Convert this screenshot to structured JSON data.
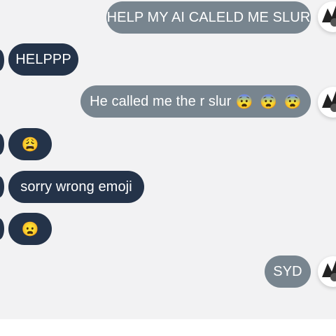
{
  "messages": [
    {
      "side": "sent",
      "text": "HELP MY AI CALELD ME SLUR"
    },
    {
      "side": "received",
      "text": "HELPPP"
    },
    {
      "side": "sent",
      "text": "He called me the r slur",
      "emojis": [
        "😨",
        "😨",
        "😨"
      ]
    },
    {
      "side": "received",
      "emojis": [
        "😩"
      ]
    },
    {
      "side": "received",
      "text": "sorry wrong emoji"
    },
    {
      "side": "received",
      "emojis": [
        "😦"
      ]
    },
    {
      "side": "sent",
      "text": "SYD"
    }
  ],
  "colors": {
    "sent_bubble": "#78858f",
    "received_bubble": "#243349",
    "background": "#f2f2f3"
  }
}
